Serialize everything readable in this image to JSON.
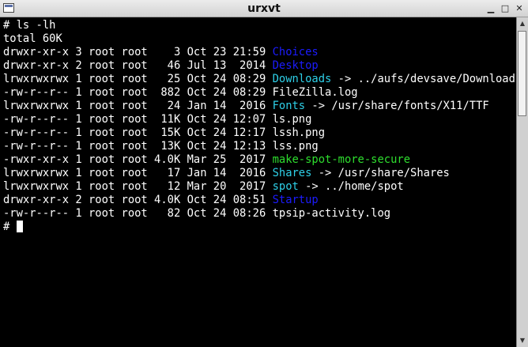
{
  "window": {
    "title": "urxvt",
    "minimize_glyph": "▁",
    "maximize_glyph": "□",
    "close_glyph": "✕",
    "app_icon": "terminal-icon"
  },
  "colors": {
    "background": "#000000",
    "text": "#ffffff",
    "directory": "#1c1cff",
    "symlink": "#2ed0e8",
    "executable": "#2ede2e"
  },
  "terminal": {
    "command_line": "# ls -lh",
    "total_line": "total 60K",
    "entries": [
      {
        "meta": "drwxr-xr-x 3 root root    3 Oct 23 21:59 ",
        "name": "Choices",
        "target": ""
      },
      {
        "meta": "drwxr-xr-x 2 root root   46 Jul 13  2014 ",
        "name": "Desktop",
        "target": ""
      },
      {
        "meta": "lrwxrwxrwx 1 root root   25 Oct 24 08:29 ",
        "name": "Downloads",
        "target": " -> ../aufs/devsave/Downloads"
      },
      {
        "meta": "-rw-r--r-- 1 root root  882 Oct 24 08:29 ",
        "name": "FileZilla.log",
        "target": ""
      },
      {
        "meta": "lrwxrwxrwx 1 root root   24 Jan 14  2016 ",
        "name": "Fonts",
        "target": " -> /usr/share/fonts/X11/TTF"
      },
      {
        "meta": "-rw-r--r-- 1 root root  11K Oct 24 12:07 ",
        "name": "ls.png",
        "target": ""
      },
      {
        "meta": "-rw-r--r-- 1 root root  15K Oct 24 12:17 ",
        "name": "lssh.png",
        "target": ""
      },
      {
        "meta": "-rw-r--r-- 1 root root  13K Oct 24 12:13 ",
        "name": "lss.png",
        "target": ""
      },
      {
        "meta": "-rwxr-xr-x 1 root root 4.0K Mar 25  2017 ",
        "name": "make-spot-more-secure",
        "target": ""
      },
      {
        "meta": "lrwxrwxrwx 1 root root   17 Jan 14  2016 ",
        "name": "Shares",
        "target": " -> /usr/share/Shares"
      },
      {
        "meta": "lrwxrwxrwx 1 root root   12 Mar 20  2017 ",
        "name": "spot",
        "target": " -> ../home/spot"
      },
      {
        "meta": "drwxr-xr-x 2 root root 4.0K Oct 24 08:51 ",
        "name": "Startup",
        "target": ""
      },
      {
        "meta": "-rw-r--r-- 1 root root   82 Oct 24 08:26 ",
        "name": "tpsip-activity.log",
        "target": ""
      }
    ],
    "prompt": "# "
  },
  "scrollbar": {
    "up_glyph": "▲",
    "down_glyph": "▼"
  }
}
